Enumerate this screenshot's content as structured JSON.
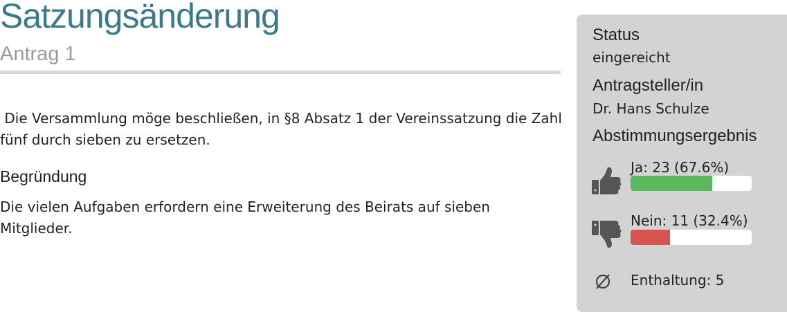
{
  "header": {
    "title": "Satzungsänderung",
    "subtitle": "Antrag 1"
  },
  "motion": {
    "text": " Die Versammlung möge beschließen, in §8 Absatz 1 der Vereinssatzung die Zahl  fünf durch sieben zu ersetzen.",
    "reason_heading": "Begründung",
    "reason_text": "Die vielen Aufgaben erfordern eine Erweiterung des Beirats auf sieben Mitglieder."
  },
  "sidebar": {
    "status_label": "Status",
    "status_value": "eingereicht",
    "applicant_label": "Antragsteller/in",
    "applicant_value": "Dr. Hans Schulze",
    "result_label": "Abstimmungsergebnis",
    "votes": {
      "yes": {
        "label": "Ja: 23 (67.6%)",
        "fraction": 0.676,
        "color": "#5cb85c",
        "icon": "thumbs-up-icon"
      },
      "no": {
        "label": "Nein: 11 (32.4%)",
        "fraction": 0.324,
        "color": "#d9534f",
        "icon": "thumbs-down-icon"
      },
      "abstain": {
        "label": "Enthaltung: 5",
        "icon": "empty-set-icon"
      }
    }
  }
}
